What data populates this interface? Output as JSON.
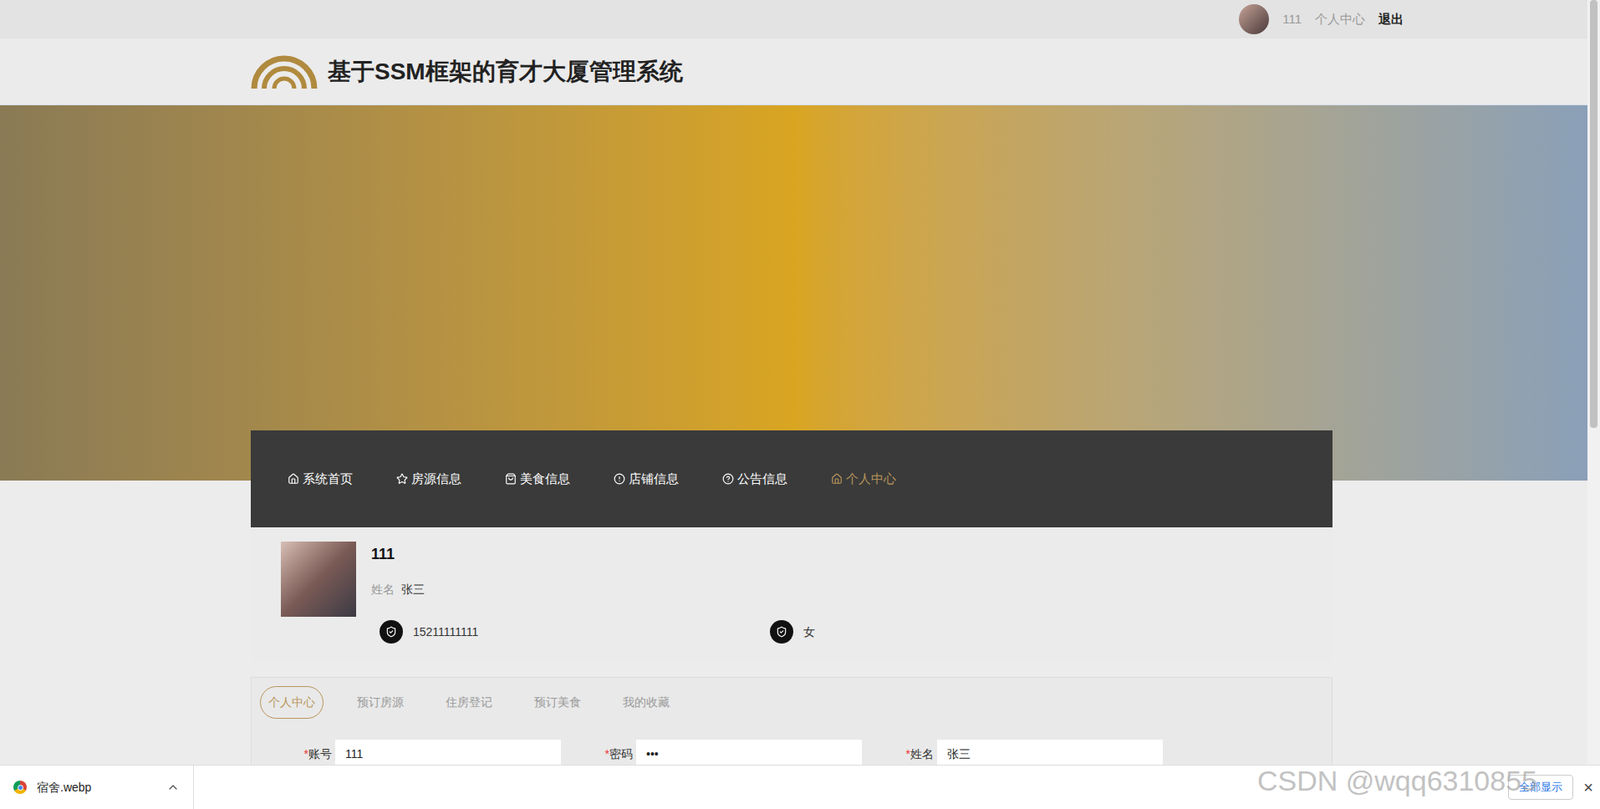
{
  "top_bar": {
    "username": "111",
    "links": [
      "个人中心",
      "退出"
    ]
  },
  "header": {
    "title": "基于SSM框架的育才大厦管理系统"
  },
  "nav": [
    {
      "label": "系统首页",
      "selected": false
    },
    {
      "label": "房源信息",
      "selected": false
    },
    {
      "label": "美食信息",
      "selected": false
    },
    {
      "label": "店铺信息",
      "selected": false
    },
    {
      "label": "公告信息",
      "selected": false
    },
    {
      "label": "个人中心",
      "selected": true
    }
  ],
  "profile": {
    "name": "111",
    "field_label": "姓名",
    "field_value": "张三",
    "phone": "15211111111",
    "gender": "女"
  },
  "tabs": [
    {
      "label": "个人中心",
      "selected": true
    },
    {
      "label": "预订房源",
      "selected": false
    },
    {
      "label": "住房登记",
      "selected": false
    },
    {
      "label": "预订美食",
      "selected": false
    },
    {
      "label": "我的收藏",
      "selected": false
    }
  ],
  "form": [
    {
      "mark": "*",
      "label": "账号",
      "value": "111"
    },
    {
      "mark": "*",
      "label": "密码",
      "value": "•••"
    },
    {
      "mark": "*",
      "label": "姓名",
      "value": "张三"
    }
  ],
  "download_bar": {
    "file": "宿舍.webp",
    "show_all": "全部显示",
    "close": "×"
  },
  "watermark": "CSDN @wqq6310855",
  "scrollbar": {
    "level": 0.56
  }
}
